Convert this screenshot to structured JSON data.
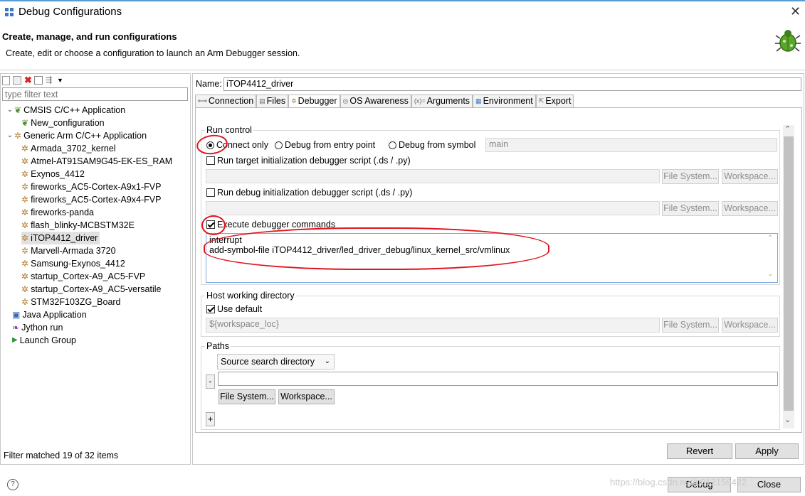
{
  "window": {
    "title": "Debug Configurations",
    "close": "✕"
  },
  "header": {
    "title": "Create, manage, and run configurations",
    "subtitle": "Create, edit or choose a configuration to launch an Arm Debugger session."
  },
  "left": {
    "filter_placeholder": "type filter text",
    "tree": [
      {
        "label": "CMSIS C/C++ Application"
      },
      {
        "label": "New_configuration"
      },
      {
        "label": "Generic Arm C/C++ Application"
      },
      {
        "label": "Armada_3702_kernel"
      },
      {
        "label": "Atmel-AT91SAM9G45-EK-ES_RAM"
      },
      {
        "label": "Exynos_4412"
      },
      {
        "label": "fireworks_AC5-Cortex-A9x1-FVP"
      },
      {
        "label": "fireworks_AC5-Cortex-A9x4-FVP"
      },
      {
        "label": "fireworks-panda"
      },
      {
        "label": "flash_blinky-MCBSTM32E"
      },
      {
        "label": "iTOP4412_driver"
      },
      {
        "label": "Marvell-Armada 3720"
      },
      {
        "label": "Samsung-Exynos_4412"
      },
      {
        "label": "startup_Cortex-A9_AC5-FVP"
      },
      {
        "label": "startup_Cortex-A9_AC5-versatile"
      },
      {
        "label": "STM32F103ZG_Board"
      },
      {
        "label": "Java Application"
      },
      {
        "label": "Jython run"
      },
      {
        "label": "Launch Group"
      }
    ],
    "status": "Filter matched 19 of 32 items"
  },
  "right": {
    "name_label": "Name:",
    "name_value": "iTOP4412_driver",
    "tabs": [
      "Connection",
      "Files",
      "Debugger",
      "OS Awareness",
      "Arguments",
      "Environment",
      "Export"
    ],
    "run_control": {
      "label": "Run control",
      "connect_only": "Connect only",
      "debug_entry": "Debug from entry point",
      "debug_symbol": "Debug from symbol",
      "symbol_value": "main",
      "run_target_script": "Run target initialization debugger script (.ds / .py)",
      "run_debug_script": "Run debug initialization debugger script (.ds / .py)",
      "execute_cmds": "Execute debugger commands",
      "commands_line1": "interrupt",
      "commands_line2": "add-symbol-file iTOP4412_driver/led_driver_debug/linux_kernel_src/vmlinux"
    },
    "host": {
      "label": "Host working directory",
      "use_default": "Use default",
      "path": "${workspace_loc}"
    },
    "paths": {
      "label": "Paths",
      "select": "Source search directory",
      "minus": "-",
      "plus": "+"
    },
    "file_system": "File System...",
    "workspace": "Workspace..."
  },
  "buttons": {
    "revert": "Revert",
    "apply": "Apply",
    "debug": "Debug",
    "close": "Close",
    "help": "?"
  },
  "watermark": "https://blog.csdn.net/u012159422"
}
